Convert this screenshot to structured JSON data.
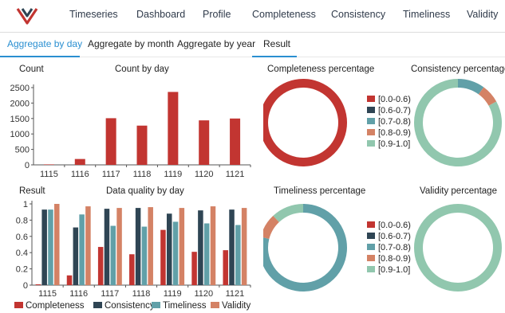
{
  "nav": {
    "items": [
      "Timeseries",
      "Dashboard",
      "Profile",
      "Completeness",
      "Consistency",
      "Timeliness",
      "Validity"
    ]
  },
  "tabs": {
    "items": [
      "Aggregate by day",
      "Aggregate by month",
      "Aggregate by year",
      "Result"
    ],
    "active": "Aggregate by day"
  },
  "count_panel": {
    "ylabel": "Count",
    "title": "Count by day"
  },
  "quality_panel": {
    "ylabel": "Result",
    "title": "Data quality by day"
  },
  "donut_titles": [
    "Completeness percentage",
    "Consistency  percentage",
    "Timeliness percentage",
    "Validity  percentage"
  ],
  "ranges": [
    "[0.0-0.6)",
    "[0.6-0.7)",
    "[0.7-0.8)",
    "[0.8-0.9)",
    "[0.9-1.0]"
  ],
  "range_colors": [
    "#c23531",
    "#2f4554",
    "#61a0a8",
    "#d48265",
    "#91c7ae"
  ],
  "chart_data": [
    {
      "type": "bar",
      "title": "Count by day",
      "ylabel": "Count",
      "xlabel": "",
      "categories": [
        "1115",
        "1116",
        "1117",
        "1118",
        "1119",
        "1120",
        "1121"
      ],
      "values": [
        15,
        190,
        1510,
        1270,
        2360,
        1440,
        1500
      ],
      "ylim": [
        0,
        2500
      ],
      "yticks": [
        0,
        500,
        1000,
        1500,
        2000,
        2500
      ],
      "color": "#c23531"
    },
    {
      "type": "bar",
      "title": "Data quality by day",
      "ylabel": "Result",
      "xlabel": "",
      "categories": [
        "1115",
        "1116",
        "1117",
        "1118",
        "1119",
        "1120",
        "1121"
      ],
      "ylim": [
        0,
        1
      ],
      "yticks": [
        0,
        0.2,
        0.4,
        0.6,
        0.8,
        1
      ],
      "legend_position": "bottom",
      "series": [
        {
          "name": "Completeness",
          "color": "#c23531",
          "values": [
            0.01,
            0.12,
            0.47,
            0.38,
            0.68,
            0.41,
            0.43
          ]
        },
        {
          "name": "Consistency",
          "color": "#2f4554",
          "values": [
            0.93,
            0.71,
            0.94,
            0.95,
            0.88,
            0.92,
            0.93
          ]
        },
        {
          "name": "Timeliness",
          "color": "#61a0a8",
          "values": [
            0.93,
            0.87,
            0.73,
            0.72,
            0.78,
            0.76,
            0.74
          ]
        },
        {
          "name": "Validity",
          "color": "#d48265",
          "values": [
            1.0,
            0.97,
            0.95,
            0.96,
            0.95,
            0.97,
            0.95
          ]
        }
      ]
    },
    {
      "type": "pie",
      "title": "Completeness percentage",
      "categories": [
        "[0.0-0.6)",
        "[0.6-0.7)",
        "[0.7-0.8)",
        "[0.8-0.9)",
        "[0.9-1.0]"
      ],
      "values": [
        100,
        0,
        0,
        0,
        0
      ],
      "legend_position": "right"
    },
    {
      "type": "pie",
      "title": "Consistency  percentage",
      "categories": [
        "[0.0-0.6)",
        "[0.6-0.7)",
        "[0.7-0.8)",
        "[0.8-0.9)",
        "[0.9-1.0]"
      ],
      "values": [
        0,
        0,
        10,
        7,
        83
      ]
    },
    {
      "type": "pie",
      "title": "Timeliness percentage",
      "categories": [
        "[0.0-0.6)",
        "[0.6-0.7)",
        "[0.7-0.8)",
        "[0.8-0.9)",
        "[0.9-1.0]"
      ],
      "values": [
        0,
        0,
        79,
        9,
        12
      ],
      "legend_position": "right"
    },
    {
      "type": "pie",
      "title": "Validity  percentage",
      "categories": [
        "[0.0-0.6)",
        "[0.6-0.7)",
        "[0.7-0.8)",
        "[0.8-0.9)",
        "[0.9-1.0]"
      ],
      "values": [
        0,
        0,
        0,
        0,
        100
      ]
    }
  ]
}
